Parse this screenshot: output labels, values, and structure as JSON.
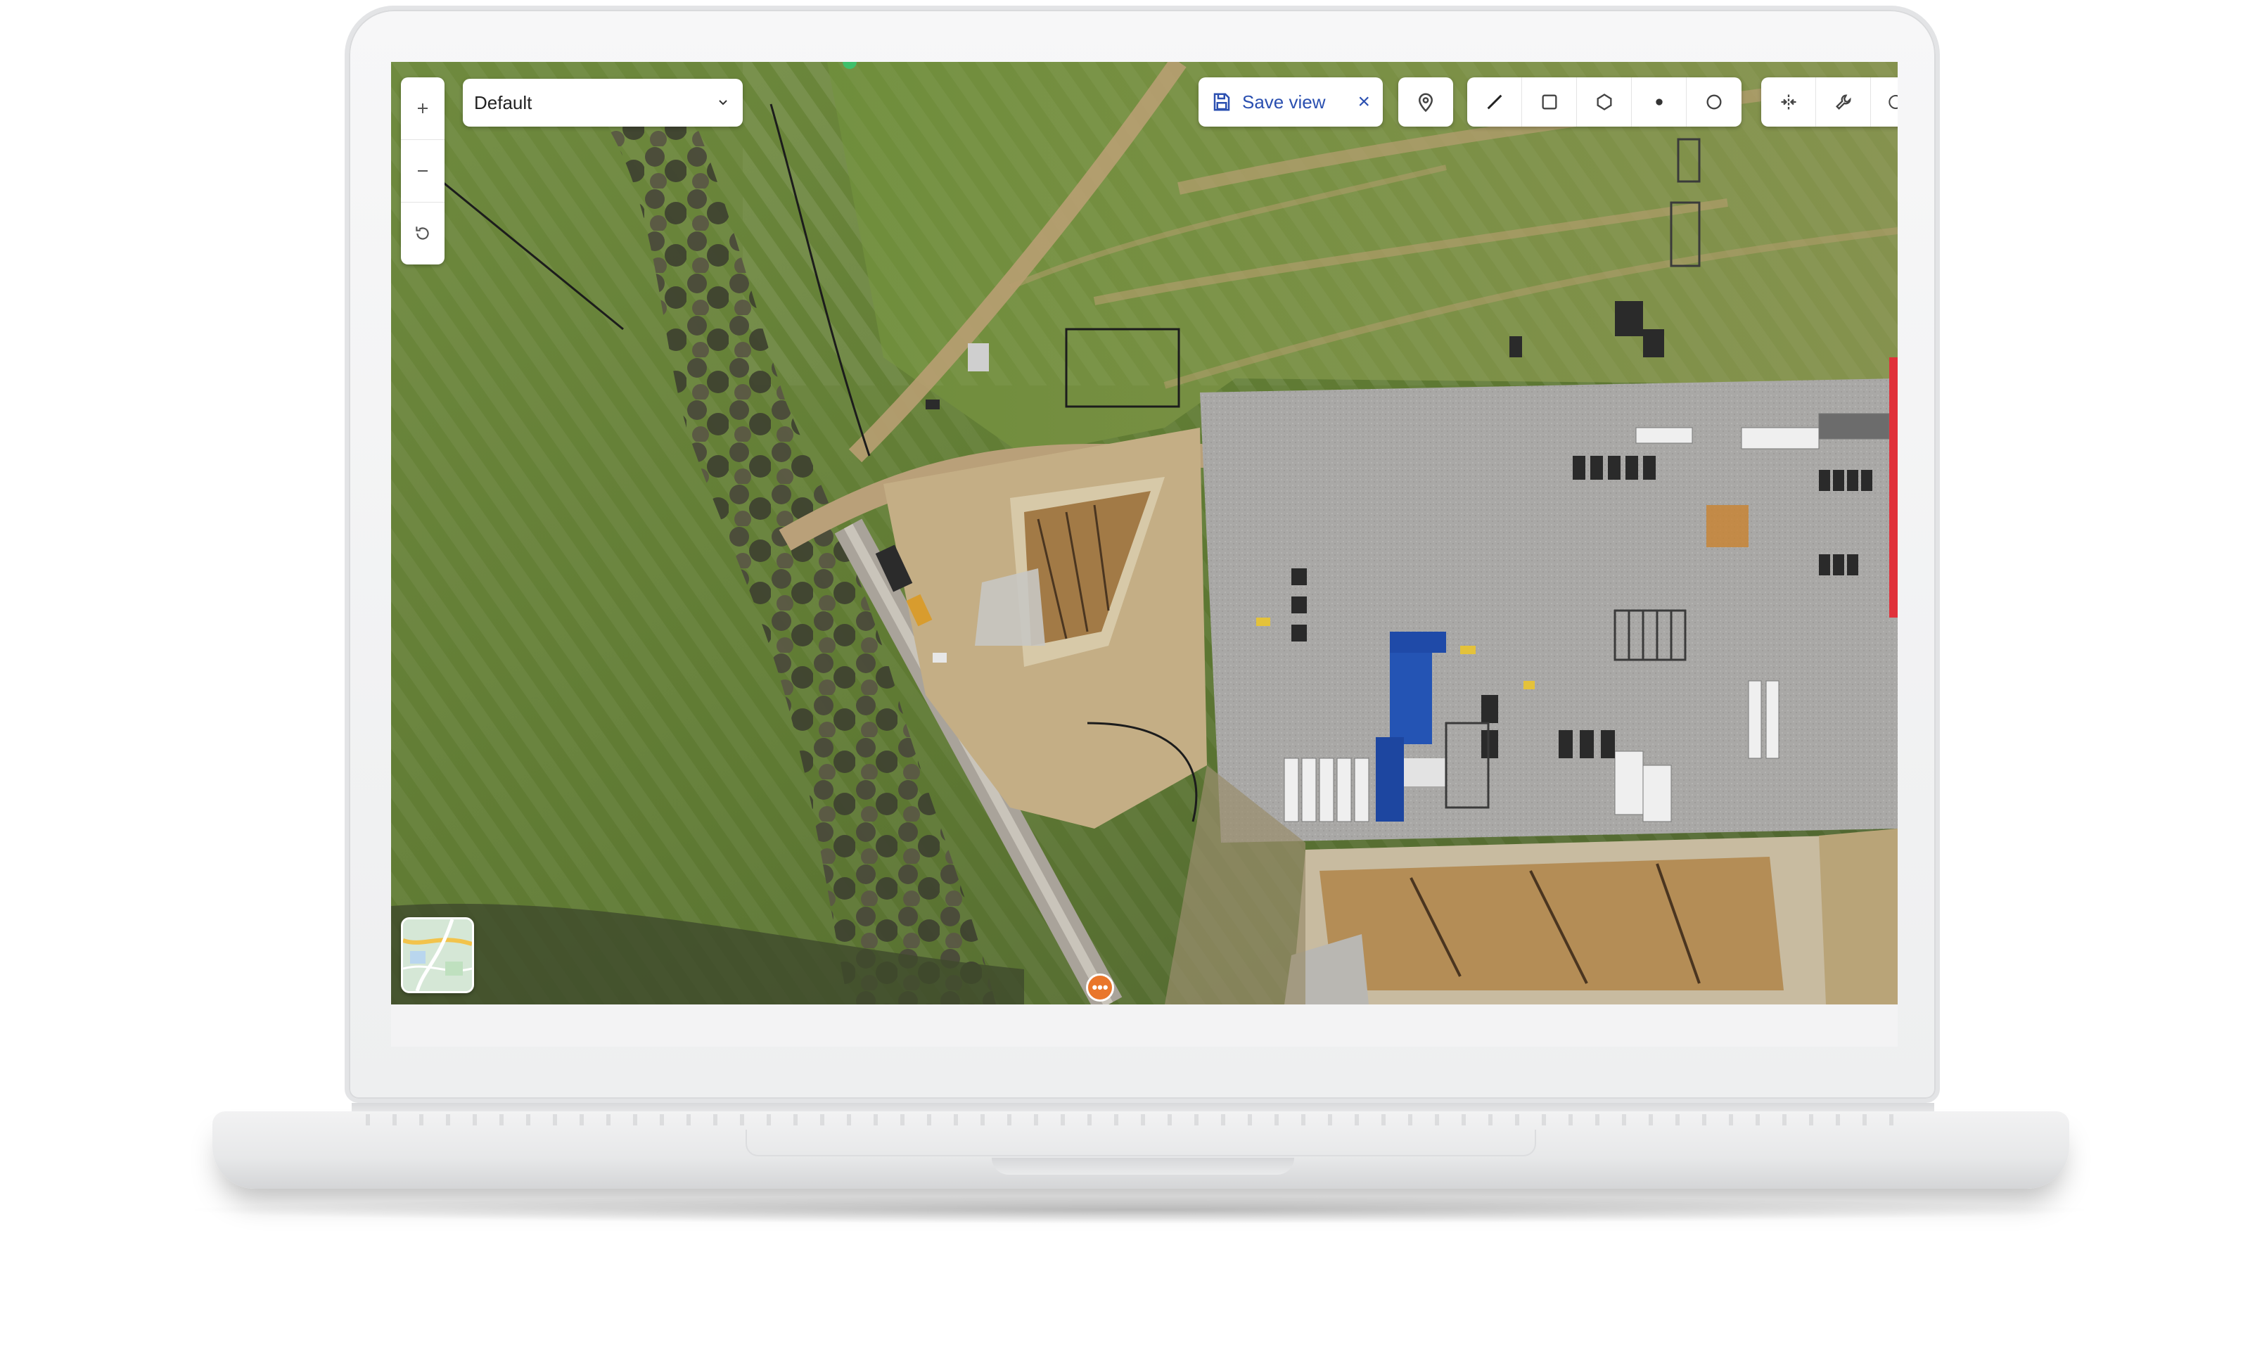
{
  "map": {
    "layer_select": {
      "value": "Default"
    },
    "zoom": {
      "in_label": "+",
      "out_label": "−"
    },
    "save_view": {
      "label": "Save view",
      "close_glyph": "×"
    },
    "marker": {
      "glyph": "•••"
    },
    "icons": {
      "zoom_in": "plus-icon",
      "zoom_out": "minus-icon",
      "reset": "reset-rotation-icon",
      "dropdown": "chevron-down-icon",
      "save": "floppy-disk-icon",
      "close": "close-icon",
      "pin": "map-pin-icon",
      "line": "line-tool-icon",
      "rectangle": "rectangle-tool-icon",
      "polygon": "polygon-tool-icon",
      "point": "point-tool-icon",
      "circle": "circle-tool-icon",
      "split": "split-tool-icon",
      "wrench": "wrench-icon",
      "more": "partial-tool-icon"
    },
    "colors": {
      "save_accent": "#2a4fb0",
      "marker": "#e9762b",
      "edge_indicator": "#e0313a"
    }
  }
}
